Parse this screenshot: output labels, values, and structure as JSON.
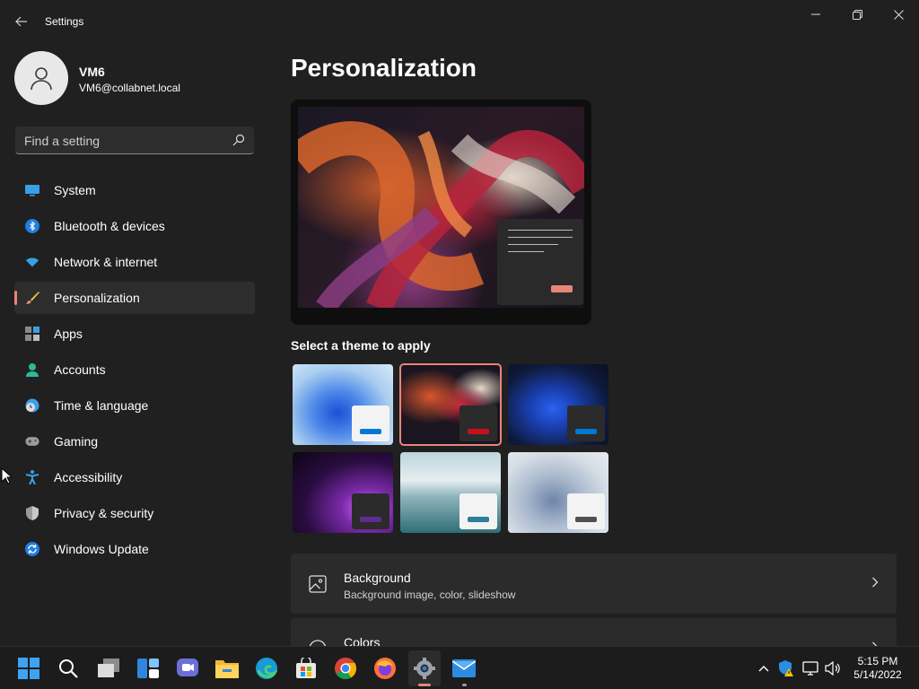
{
  "window": {
    "app_title": "Settings"
  },
  "user": {
    "name": "VM6",
    "email": "VM6@collabnet.local"
  },
  "search": {
    "placeholder": "Find a setting"
  },
  "sidebar": {
    "items": [
      {
        "label": "System",
        "icon": "system-icon"
      },
      {
        "label": "Bluetooth & devices",
        "icon": "bluetooth-icon"
      },
      {
        "label": "Network & internet",
        "icon": "wifi-icon"
      },
      {
        "label": "Personalization",
        "icon": "brush-icon",
        "active": true
      },
      {
        "label": "Apps",
        "icon": "apps-icon"
      },
      {
        "label": "Accounts",
        "icon": "account-icon"
      },
      {
        "label": "Time & language",
        "icon": "clock-globe-icon"
      },
      {
        "label": "Gaming",
        "icon": "gamepad-icon"
      },
      {
        "label": "Accessibility",
        "icon": "accessibility-icon"
      },
      {
        "label": "Privacy & security",
        "icon": "shield-icon"
      },
      {
        "label": "Windows Update",
        "icon": "update-icon"
      }
    ]
  },
  "main": {
    "title": "Personalization",
    "themes_label": "Select a theme to apply",
    "themes": [
      {
        "name": "windows-light",
        "accent": "#0078d4"
      },
      {
        "name": "glow",
        "accent": "#c50f1f",
        "selected": true
      },
      {
        "name": "windows-dark",
        "accent": "#0078d4"
      },
      {
        "name": "captured-motion",
        "accent": "#5c2e91"
      },
      {
        "name": "flow",
        "accent": "#2d7d9a"
      },
      {
        "name": "sunrise",
        "accent": "#505050"
      }
    ],
    "cards": [
      {
        "title": "Background",
        "subtitle": "Background image, color, slideshow",
        "icon": "image-icon"
      },
      {
        "title": "Colors",
        "subtitle": "",
        "icon": "palette-icon"
      }
    ]
  },
  "taskbar": {
    "apps": [
      "start-icon",
      "search-icon",
      "task-view-icon",
      "widgets-icon",
      "teams-chat-icon",
      "file-explorer-icon",
      "edge-icon",
      "store-icon",
      "chrome-icon",
      "firefox-icon",
      "settings-icon",
      "mail-icon"
    ],
    "clock_time": "5:15 PM",
    "clock_date": "5/14/2022"
  },
  "colors": {
    "accent": "#e8857a",
    "window_bg": "#202020",
    "card_bg": "#2b2b2b"
  }
}
